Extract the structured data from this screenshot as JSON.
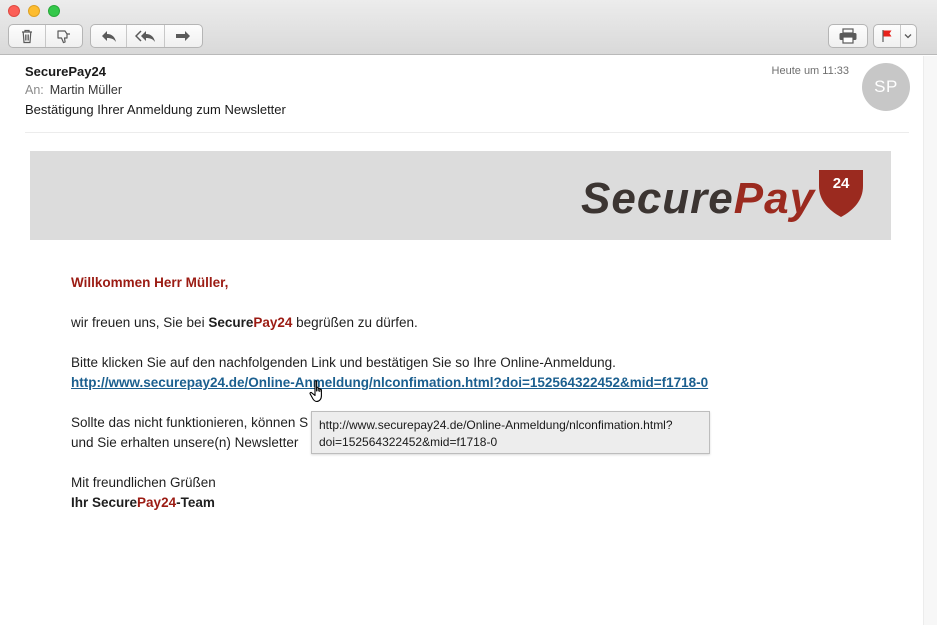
{
  "toolbar": {
    "buttons": [
      "trash-icon",
      "junk-icon",
      "reply-icon",
      "reply-all-icon",
      "forward-icon",
      "print-icon",
      "flag-icon"
    ]
  },
  "message": {
    "sender": "SecurePay24",
    "to_label": "An:",
    "to_name": "Martin Müller",
    "subject": "Bestätigung Ihrer Anmeldung zum Newsletter",
    "time": "Heute um 11:33",
    "avatar_initials": "SP"
  },
  "banner": {
    "logo_secure": "Secure",
    "logo_pay": "Pay",
    "logo_number": "24"
  },
  "body": {
    "greeting": "Willkommen Herr Müller,",
    "line1_pre": "wir freuen uns, Sie bei ",
    "brand_secure": "Secure",
    "brand_pay": "Pay24",
    "line1_post": " begrüßen zu dürfen.",
    "line2": "Bitte klicken Sie auf den nachfolgenden Link und bestätigen Sie so Ihre Online-Anmeldung.",
    "link": "http://www.securepay24.de/Online-Anmeldung/nlconfimation.html?doi=152564322452&mid=f1718-0",
    "line3": "Sollte das nicht funktionieren, können S",
    "line4": "und Sie erhalten unsere(n) Newsletter",
    "closing": "Mit freundlichen Grüßen",
    "sig_pre": "Ihr ",
    "sig_secure": "Secure",
    "sig_pay": "Pay24",
    "sig_post": "-Team"
  },
  "tooltip": {
    "line1": "http://www.securepay24.de/Online-Anmeldung/nlconfimation.html?",
    "line2": "doi=152564322452&mid=f1718-0"
  },
  "colors": {
    "brand_red": "#9b1b13",
    "link_blue": "#1b5f8f",
    "banner_gray": "#dcdcdc"
  }
}
